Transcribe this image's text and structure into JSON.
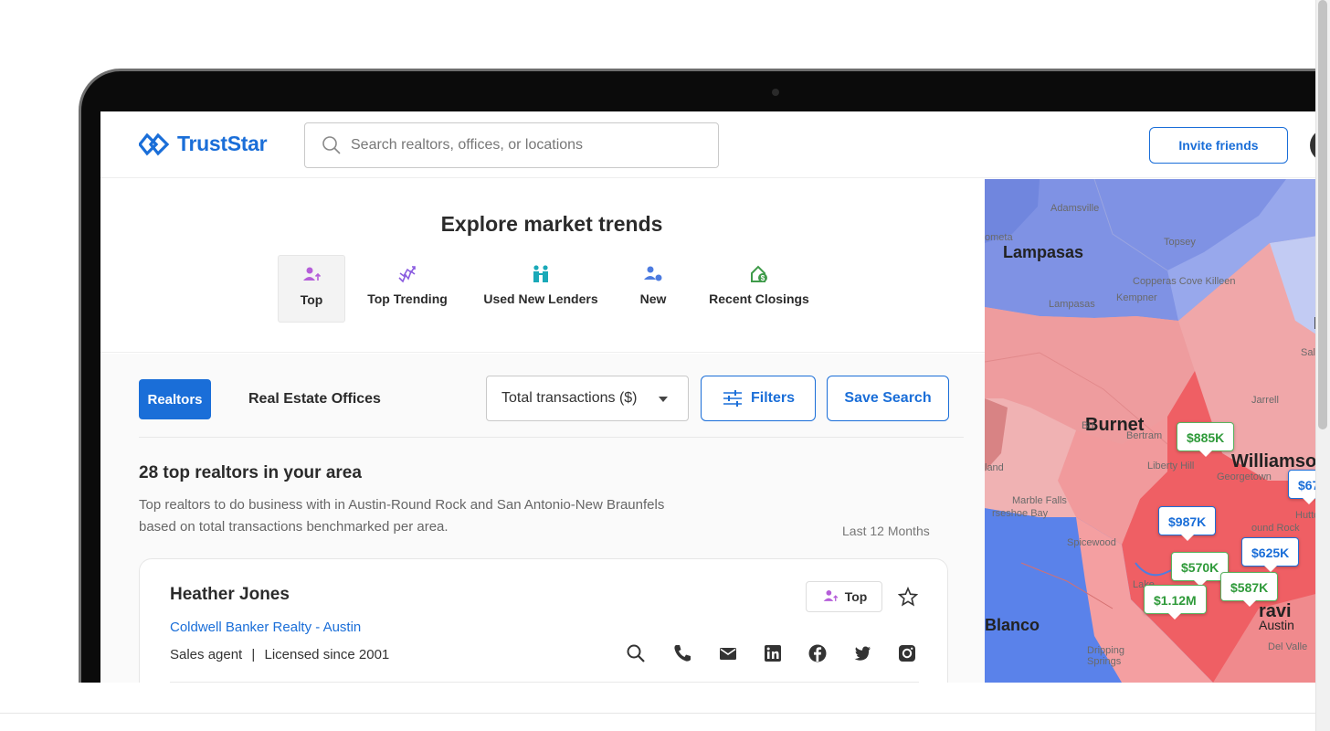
{
  "header": {
    "logo_text": "TrustStar",
    "search_placeholder": "Search realtors, offices, or locations",
    "invite_label": "Invite friends"
  },
  "trends": {
    "title": "Explore market trends",
    "tabs": [
      {
        "label": "Top",
        "icon": "person-arrow-icon",
        "color": "#b55ed9",
        "active": true
      },
      {
        "label": "Top Trending",
        "icon": "trend-chart-icon",
        "color": "#8a5be0",
        "active": false
      },
      {
        "label": "Used New Lenders",
        "icon": "people-icon",
        "color": "#1aa9b8",
        "active": false
      },
      {
        "label": "New",
        "icon": "person-new-icon",
        "color": "#4c7be0",
        "active": false
      },
      {
        "label": "Recent Closings",
        "icon": "house-dollar-icon",
        "color": "#3f9b4a",
        "active": false
      }
    ]
  },
  "filters": {
    "realtors_label": "Realtors",
    "offices_label": "Real Estate Offices",
    "sort_value": "Total transactions ($)",
    "filters_label": "Filters",
    "save_label": "Save Search"
  },
  "results": {
    "title": "28 top realtors in your area",
    "description": "Top realtors to do business with in Austin-Round Rock and San Antonio-New Braunfels based on total transactions benchmarked per area.",
    "period": "Last 12 Months"
  },
  "card": {
    "name": "Heather Jones",
    "office": "Coldwell Banker Realty - Austin",
    "role": "Sales agent",
    "separator": "|",
    "licensed": "Licensed since 2001",
    "badge": "Top",
    "social_icons": [
      "search-icon",
      "phone-icon",
      "email-icon",
      "linkedin-icon",
      "facebook-icon",
      "twitter-icon",
      "instagram-icon"
    ]
  },
  "map": {
    "places": {
      "lampasas": "Lampasas",
      "burnet": "Burnet",
      "williamson": "Williamso",
      "blanco": "Blanco",
      "austin": "Austin",
      "travis": "ravi",
      "adamsville": "Adamsville",
      "topsey": "Topsey",
      "copperas": "Copperas Cove Killeen",
      "kempner": "Kempner",
      "lampasas_small": "Lampasas",
      "bertram": "Bertram",
      "liberty_hill": "Liberty Hill",
      "georgetown": "Georgetown",
      "marble_falls": "Marble Falls",
      "horseshoe_bay": "rseshoe Bay",
      "spicewood": "Spicewood",
      "round_rock": "ound Rock",
      "hutto": "Hutto",
      "jarrell": "Jarrell",
      "salado": "Salado",
      "dripping": "Dripping Springs",
      "del_valle": "Del Valle",
      "cometa": "ometa",
      "bu": "Bu",
      "lake": "Lake",
      "land": "land",
      "e": "E"
    },
    "pins": [
      {
        "label": "$885K",
        "style": "green"
      },
      {
        "label": "$67",
        "style": "blue"
      },
      {
        "label": "$987K",
        "style": "blue"
      },
      {
        "label": "$625K",
        "style": "blue"
      },
      {
        "label": "$570K",
        "style": "green"
      },
      {
        "label": "$587K",
        "style": "green"
      },
      {
        "label": "$1.12M",
        "style": "green"
      }
    ]
  }
}
